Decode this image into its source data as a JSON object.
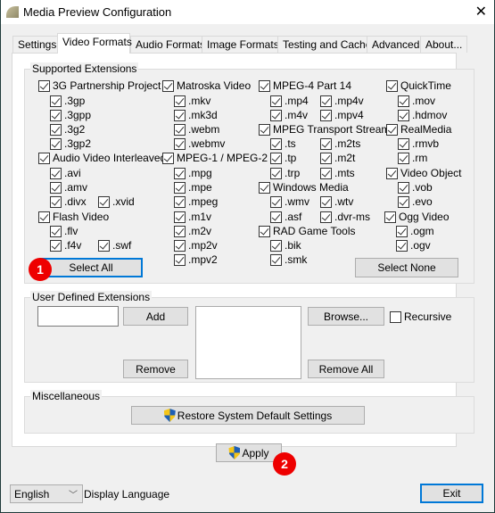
{
  "window": {
    "title": "Media Preview Configuration"
  },
  "tabs": [
    {
      "label": "Settings"
    },
    {
      "label": "Video Formats",
      "active": true
    },
    {
      "label": "Audio Formats"
    },
    {
      "label": "Image Formats"
    },
    {
      "label": "Testing and Cache"
    },
    {
      "label": "Advanced"
    },
    {
      "label": "About..."
    }
  ],
  "supported": {
    "title": "Supported Extensions",
    "items": [
      {
        "label": "3G Partnership Project",
        "checked": true
      },
      {
        "label": ".3gp",
        "checked": true
      },
      {
        "label": ".3gpp",
        "checked": true
      },
      {
        "label": ".3g2",
        "checked": true
      },
      {
        "label": ".3gp2",
        "checked": true
      },
      {
        "label": "Audio Video Interleaved",
        "checked": true
      },
      {
        "label": ".avi",
        "checked": true
      },
      {
        "label": ".amv",
        "checked": true
      },
      {
        "label": ".divx",
        "checked": true
      },
      {
        "label": ".xvid",
        "checked": true
      },
      {
        "label": "Flash Video",
        "checked": true
      },
      {
        "label": ".flv",
        "checked": true
      },
      {
        "label": ".f4v",
        "checked": true
      },
      {
        "label": ".swf",
        "checked": true
      },
      {
        "label": "Matroska Video",
        "checked": true
      },
      {
        "label": ".mkv",
        "checked": true
      },
      {
        "label": ".mk3d",
        "checked": true
      },
      {
        "label": ".webm",
        "checked": true
      },
      {
        "label": ".webmv",
        "checked": true
      },
      {
        "label": "MPEG-1 / MPEG-2",
        "checked": true
      },
      {
        "label": ".mpg",
        "checked": true
      },
      {
        "label": ".mpe",
        "checked": true
      },
      {
        "label": ".mpeg",
        "checked": true
      },
      {
        "label": ".m1v",
        "checked": true
      },
      {
        "label": ".m2v",
        "checked": true
      },
      {
        "label": ".mp2v",
        "checked": true
      },
      {
        "label": ".mpv2",
        "checked": true
      },
      {
        "label": "MPEG-4 Part 14",
        "checked": true
      },
      {
        "label": ".mp4",
        "checked": true
      },
      {
        "label": ".mp4v",
        "checked": true
      },
      {
        "label": ".m4v",
        "checked": true
      },
      {
        "label": ".mpv4",
        "checked": true
      },
      {
        "label": "MPEG Transport Stream",
        "checked": true
      },
      {
        "label": ".ts",
        "checked": true
      },
      {
        "label": ".m2ts",
        "checked": true
      },
      {
        "label": ".tp",
        "checked": true
      },
      {
        "label": ".m2t",
        "checked": true
      },
      {
        "label": ".trp",
        "checked": true
      },
      {
        "label": ".mts",
        "checked": true
      },
      {
        "label": "Windows Media",
        "checked": true
      },
      {
        "label": ".wmv",
        "checked": true
      },
      {
        "label": ".wtv",
        "checked": true
      },
      {
        "label": ".asf",
        "checked": true
      },
      {
        "label": ".dvr-ms",
        "checked": true
      },
      {
        "label": "RAD Game Tools",
        "checked": true
      },
      {
        "label": ".bik",
        "checked": true
      },
      {
        "label": ".smk",
        "checked": true
      },
      {
        "label": "QuickTime",
        "checked": true
      },
      {
        "label": ".mov",
        "checked": true
      },
      {
        "label": ".hdmov",
        "checked": true
      },
      {
        "label": "RealMedia",
        "checked": true
      },
      {
        "label": ".rmvb",
        "checked": true
      },
      {
        "label": ".rm",
        "checked": true
      },
      {
        "label": "Video Object",
        "checked": true
      },
      {
        "label": ".vob",
        "checked": true
      },
      {
        "label": ".evo",
        "checked": true
      },
      {
        "label": "Ogg Video",
        "checked": true
      },
      {
        "label": ".ogm",
        "checked": true
      },
      {
        "label": ".ogv",
        "checked": true
      }
    ],
    "select_all": "Select All",
    "select_none": "Select None"
  },
  "user_defined": {
    "title": "User Defined Extensions",
    "input_value": "",
    "add": "Add",
    "remove": "Remove",
    "browse": "Browse...",
    "recursive": "Recursive",
    "recursive_checked": false,
    "remove_all": "Remove All"
  },
  "misc": {
    "title": "Miscellaneous",
    "restore": "Restore System Default Settings"
  },
  "apply": "Apply",
  "language": {
    "value": "English",
    "label": "Display Language"
  },
  "exit": "Exit",
  "badges": [
    "1",
    "2"
  ]
}
